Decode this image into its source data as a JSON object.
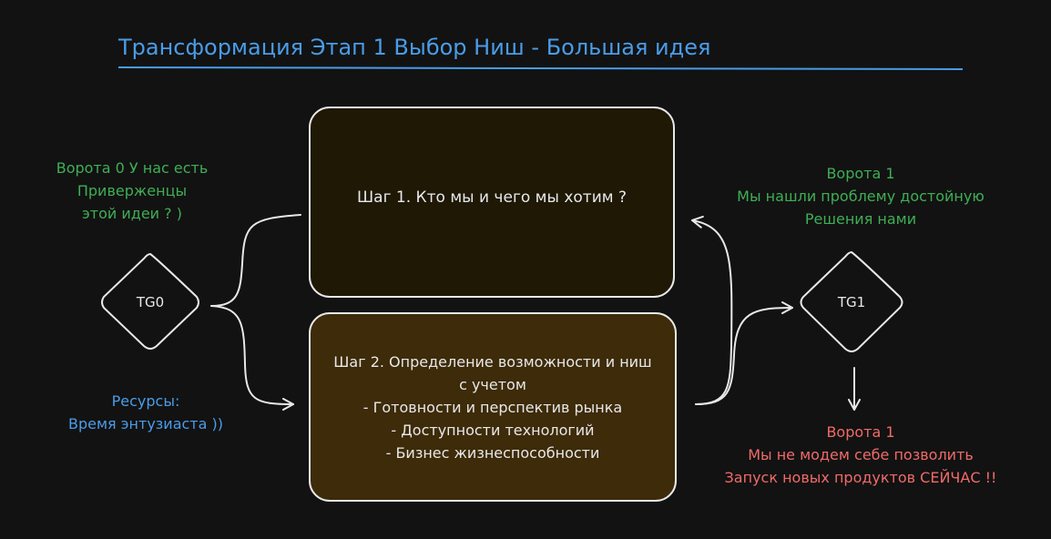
{
  "title": "Трансформация Этап 1 Выбор Ниш - Большая идея",
  "colors": {
    "background": "#121212",
    "title_blue": "#4a9ce8",
    "green": "#3fae55",
    "red": "#f06a6a",
    "stroke": "#e8e8e8",
    "box1_fill": "#1e1805",
    "box2_fill": "#3d2b09"
  },
  "boxes": {
    "step1": {
      "text": "Шаг 1. Кто мы и чего мы хотим ?"
    },
    "step2": {
      "text": "Шаг 2. Определение возможности и ниш\nс учетом\n- Готовности и перспектив рынка\n- Доступности технологий\n- Бизнес жизнеспособности"
    }
  },
  "gates": {
    "tg0": {
      "label": "TG0"
    },
    "tg1": {
      "label": "TG1"
    }
  },
  "annotations": {
    "gate0": "Ворота 0 У нас есть\nПриверженцы\nэтой идеи ? )",
    "gate1": "Ворота 1\nМы нашли проблему достойную\nРешения нами",
    "gate1_warning": "Ворота 1\nМы не модем себе позволить\nЗапуск новых продуктов СЕЙЧАС !!",
    "resources": "Ресурсы:\nВремя энтузиаста ))"
  }
}
